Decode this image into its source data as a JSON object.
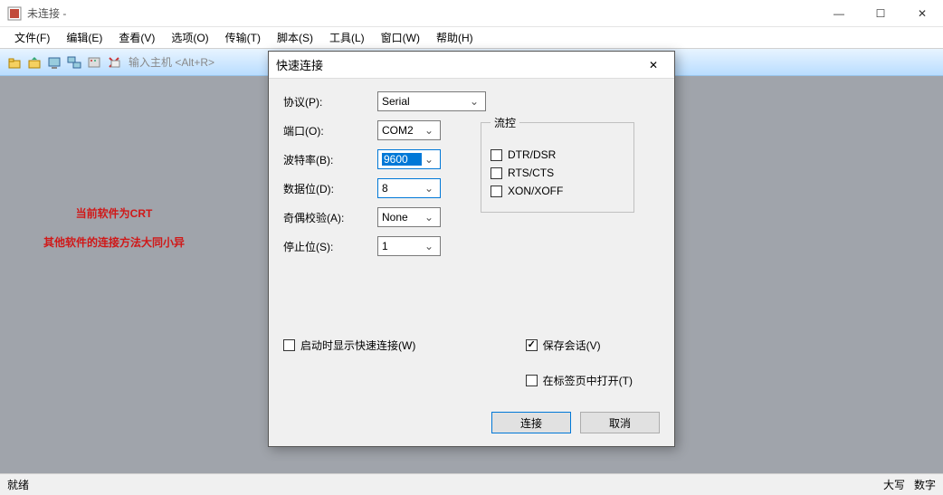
{
  "window": {
    "title": "未连接 -",
    "min": "—",
    "max": "☐",
    "close": "✕"
  },
  "menubar": [
    "文件(F)",
    "编辑(E)",
    "查看(V)",
    "选项(O)",
    "传输(T)",
    "脚本(S)",
    "工具(L)",
    "窗口(W)",
    "帮助(H)"
  ],
  "toolbar": {
    "host_placeholder": "输入主机 <Alt+R>"
  },
  "annotation": {
    "line1": "当前软件为CRT",
    "line2": "其他软件的连接方法大同小异"
  },
  "statusbar": {
    "ready": "就绪",
    "caps": "大写",
    "num": "数字"
  },
  "dialog": {
    "title": "快速连接",
    "close": "✕",
    "labels": {
      "protocol": "协议(P):",
      "port": "端口(O):",
      "baud": "波特率(B):",
      "databits": "数据位(D):",
      "parity": "奇偶校验(A):",
      "stopbits": "停止位(S):",
      "flow": "流控"
    },
    "values": {
      "protocol": "Serial",
      "port": "COM2",
      "baud": "9600",
      "databits": "8",
      "parity": "None",
      "stopbits": "1"
    },
    "flow": {
      "dtr": "DTR/DSR",
      "rts": "RTS/CTS",
      "xon": "XON/XOFF"
    },
    "opts": {
      "startup": "启动时显示快速连接(W)",
      "save": "保存会话(V)",
      "tab": "在标签页中打开(T)"
    },
    "buttons": {
      "connect": "连接",
      "cancel": "取消"
    }
  }
}
